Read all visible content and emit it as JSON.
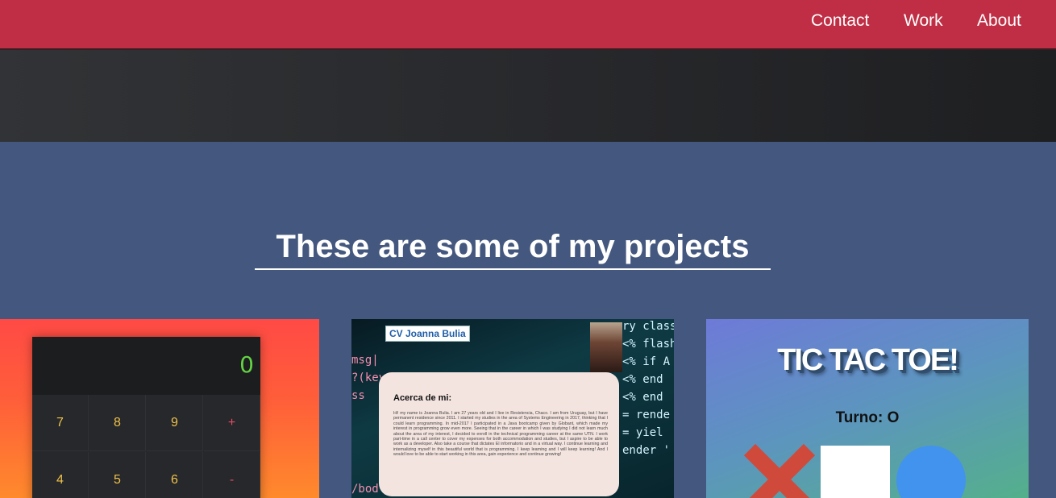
{
  "nav": {
    "links": [
      "Contact",
      "Work",
      "About"
    ]
  },
  "projects": {
    "heading": "These are some of my projects",
    "calculator": {
      "display_value": "0",
      "keys": [
        "7",
        "8",
        "9",
        "+",
        "4",
        "5",
        "6",
        "-"
      ]
    },
    "cv": {
      "title": "CV Joanna Bulia",
      "heading": "Acerca de mi:",
      "body": "Hi! my name is Joanna Bulia. I am 27 years old and I live in Resistencia, Chaco. I am from Uruguay, but I have permanent residence since 2011. I started my studies in the area of Systems Engineering in 2017, thinking that I could learn programming. In mid-2017 I participated in a Java bootcamp given by Globant, which made my interest in programming grow even more. Seeing that in the career in which I was studying I did not learn much about the area of my interest, I decided to enroll in the technical programming career at the same UTN. I work part-time in a call center to cover my expenses for both accommodation and studies, but I aspire to be able to work as a developer. Also take a course that dictates El informatorio and in a virtual way. I continue learning and internalizing myself in this beautiful world that is programming. I keep learning and I will keep learning! And I would love to be able to start working in this area, gain experience and continue growing!",
      "code_lines": [
        "ry class",
        "<% flash.",
        "<% if A",
        "<% end",
        "<% end",
        "= rende",
        "= yiel",
        "ender '"
      ],
      "code_left": [
        "msg|",
        "?(key.",
        "ss",
        "/bod"
      ]
    },
    "tictactoe": {
      "title": "TIC TAC TOE!",
      "turn": "Turno: O"
    }
  }
}
